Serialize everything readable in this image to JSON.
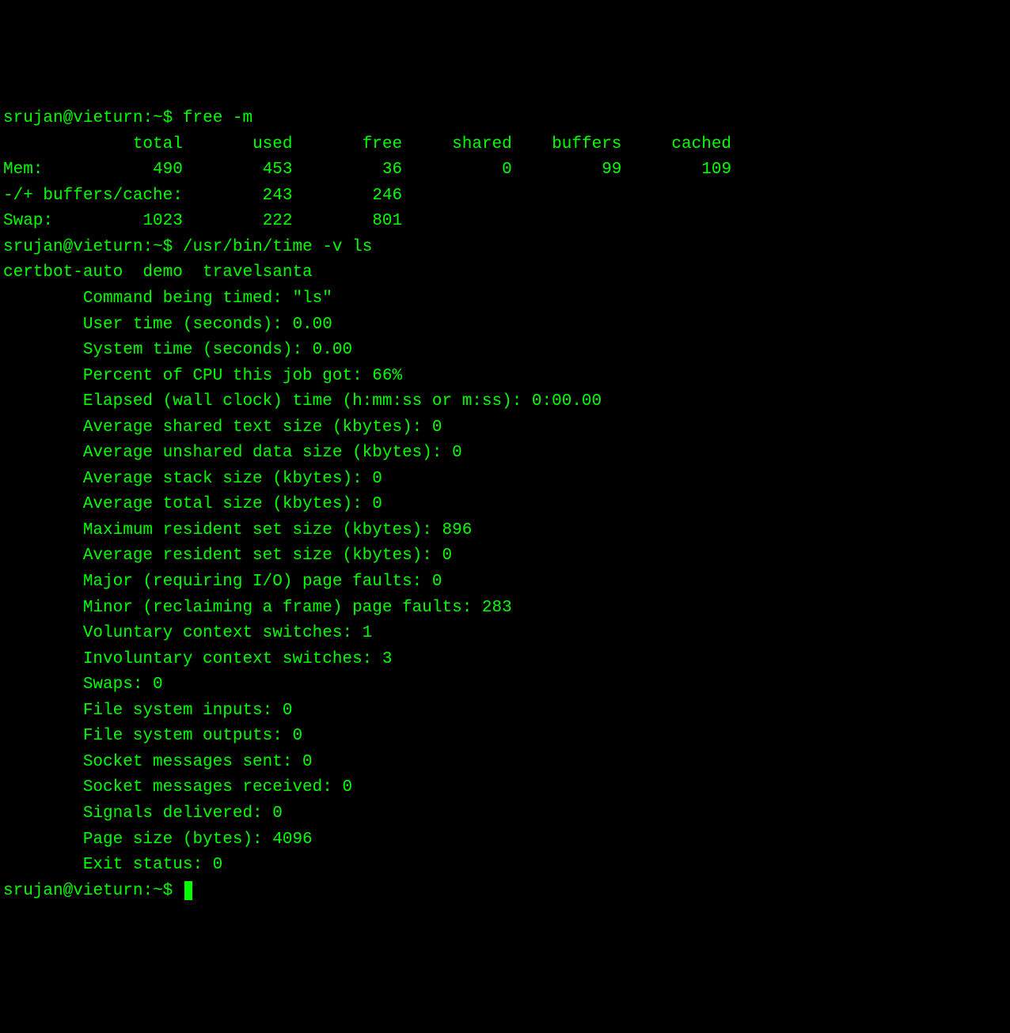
{
  "prompt": {
    "user": "srujan",
    "host": "vieturn",
    "path": "~",
    "symbol": "$"
  },
  "cmd1": "free -m",
  "free_header": {
    "c1": "total",
    "c2": "used",
    "c3": "free",
    "c4": "shared",
    "c5": "buffers",
    "c6": "cached"
  },
  "free_rows": {
    "mem": {
      "label": "Mem:",
      "total": "490",
      "used": "453",
      "free": "36",
      "shared": "0",
      "buffers": "99",
      "cached": "109"
    },
    "bc": {
      "label": "-/+ buffers/cache:",
      "used": "243",
      "free": "246"
    },
    "swap": {
      "label": "Swap:",
      "total": "1023",
      "used": "222",
      "free": "801"
    }
  },
  "cmd2": "/usr/bin/time -v ls",
  "ls_output": "certbot-auto  demo  travelsanta",
  "time_lines": [
    "Command being timed: \"ls\"",
    "User time (seconds): 0.00",
    "System time (seconds): 0.00",
    "Percent of CPU this job got: 66%",
    "Elapsed (wall clock) time (h:mm:ss or m:ss): 0:00.00",
    "Average shared text size (kbytes): 0",
    "Average unshared data size (kbytes): 0",
    "Average stack size (kbytes): 0",
    "Average total size (kbytes): 0",
    "Maximum resident set size (kbytes): 896",
    "Average resident set size (kbytes): 0",
    "Major (requiring I/O) page faults: 0",
    "Minor (reclaiming a frame) page faults: 283",
    "Voluntary context switches: 1",
    "Involuntary context switches: 3",
    "Swaps: 0",
    "File system inputs: 0",
    "File system outputs: 0",
    "Socket messages sent: 0",
    "Socket messages received: 0",
    "Signals delivered: 0",
    "Page size (bytes): 4096",
    "Exit status: 0"
  ]
}
